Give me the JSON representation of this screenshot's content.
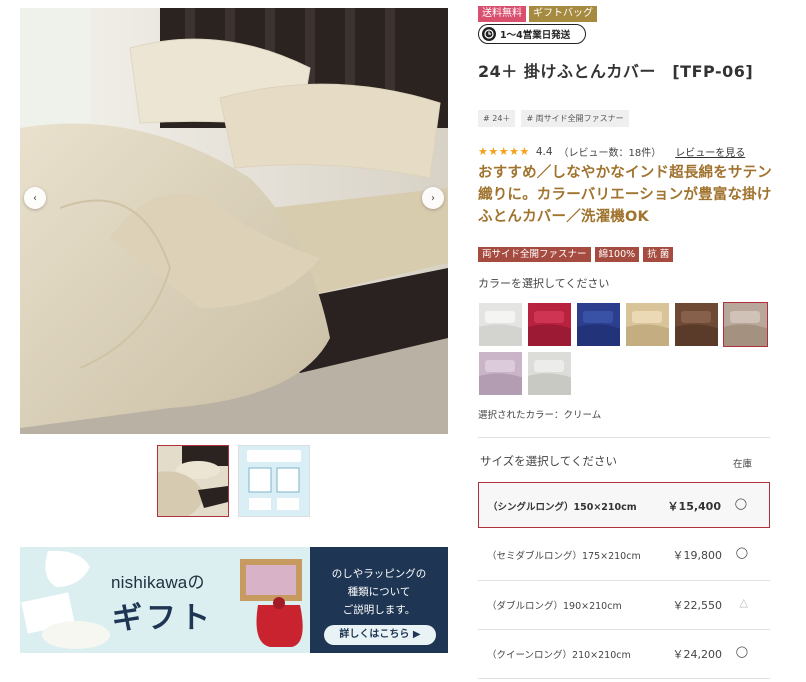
{
  "gallery": {
    "prev_label": "‹",
    "next_label": "›"
  },
  "gift_banner": {
    "brand": "nishikawaの",
    "title": "ギフト",
    "copy_line1": "のしやラッピングの",
    "copy_line2": "種類について",
    "copy_line3": "ご説明します。",
    "cta": "詳しくはこちら ▶"
  },
  "product": {
    "badges": [
      "送料無料",
      "ギフトバッグ"
    ],
    "shipping": "1〜4営業日発送",
    "title": "24＋ 掛けふとんカバー　[TFP-06]",
    "tags": [
      "# 24＋",
      "# 両サイド全開ファスナー"
    ],
    "rating": {
      "stars": "★★★★★",
      "value": "4.4",
      "count_text": "（レビュー数：18件）",
      "review_link": "レビューを見る"
    },
    "catch_copy": "おすすめ／しなやかなインド超長綿をサテン織りに。カラーバリエーションが豊富な掛けふとんカバー／洗濯機OK",
    "features": [
      "両サイド全開ファスナー",
      "綿100%",
      "抗 菌"
    ],
    "color_label": "カラーを選択してください",
    "selected_color": "選択されたカラー：クリーム",
    "size_label": "サイズを選択してください",
    "stock_label": "在庫",
    "sizes": [
      {
        "name": "（シングルロング）150×210cm",
        "price": "￥15,400",
        "stock": "◯"
      },
      {
        "name": "（セミダブルロング）175×210cm",
        "price": "￥19,800",
        "stock": "◯"
      },
      {
        "name": "（ダブルロング）190×210cm",
        "price": "￥22,550",
        "stock": "△"
      },
      {
        "name": "（クイーンロング）210×210cm",
        "price": "￥24,200",
        "stock": "◯"
      }
    ]
  },
  "colors": {
    "accent": "#b0303c",
    "catch": "#a0732e",
    "badge_free": "#d94f6e",
    "badge_gift": "#a58a3f",
    "feature": "#a64b3f",
    "star": "#f1a21a",
    "swatches": [
      "#e4e4e2",
      "#b8223e",
      "#2b3f8e",
      "#d9c49a",
      "#6e4a35",
      "#b8a79a",
      "#c9b4c8",
      "#dcdcd8"
    ]
  }
}
